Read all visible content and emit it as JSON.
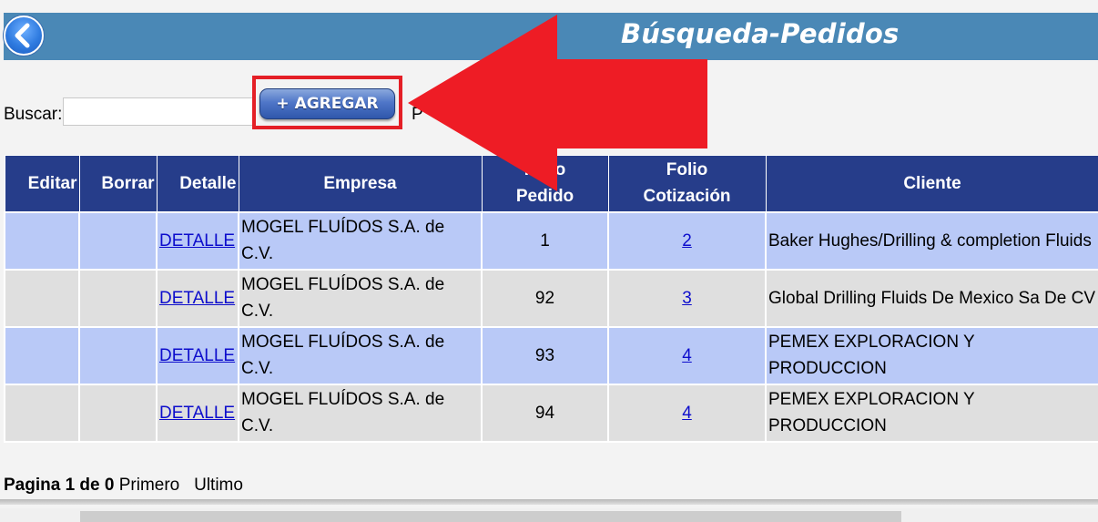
{
  "header": {
    "title": "Búsqueda-Pedidos",
    "back_icon": "chevron-left-icon",
    "bg_color": "#4a88b6"
  },
  "search": {
    "label": "Buscar:",
    "value": "",
    "placeholder": "",
    "partial_label": "P"
  },
  "toolbar": {
    "add_label": "+ AGREGAR",
    "highlight_color": "#e41f26"
  },
  "table": {
    "header_color": "#263d8a",
    "columns": [
      "Editar",
      "Borrar",
      "Detalle",
      "Empresa",
      "Folio\nPedido",
      "Folio\nCotización",
      "Cliente"
    ],
    "rows": [
      {
        "detalle": "DETALLE",
        "empresa": "MOGEL FLUÍDOS S.A. de C.V.",
        "folio_pedido": "1",
        "folio_cotizacion": "2",
        "cliente": "Baker Hughes/Drilling & completion Fluids"
      },
      {
        "detalle": "DETALLE",
        "empresa": "MOGEL FLUÍDOS S.A. de C.V.",
        "folio_pedido": "92",
        "folio_cotizacion": "3",
        "cliente": "Global Drilling Fluids De Mexico Sa De CV"
      },
      {
        "detalle": "DETALLE",
        "empresa": "MOGEL FLUÍDOS S.A. de C.V.",
        "folio_pedido": "93",
        "folio_cotizacion": "4",
        "cliente": "PEMEX EXPLORACION Y PRODUCCION"
      },
      {
        "detalle": "DETALLE",
        "empresa": "MOGEL FLUÍDOS S.A. de C.V.",
        "folio_pedido": "94",
        "folio_cotizacion": "4",
        "cliente": "PEMEX EXPLORACION Y PRODUCCION"
      }
    ]
  },
  "pager": {
    "status": "Pagina 1 de 0",
    "first": "Primero",
    "last": "Ultimo"
  },
  "annotation": {
    "arrow_color": "#ee1c25"
  }
}
